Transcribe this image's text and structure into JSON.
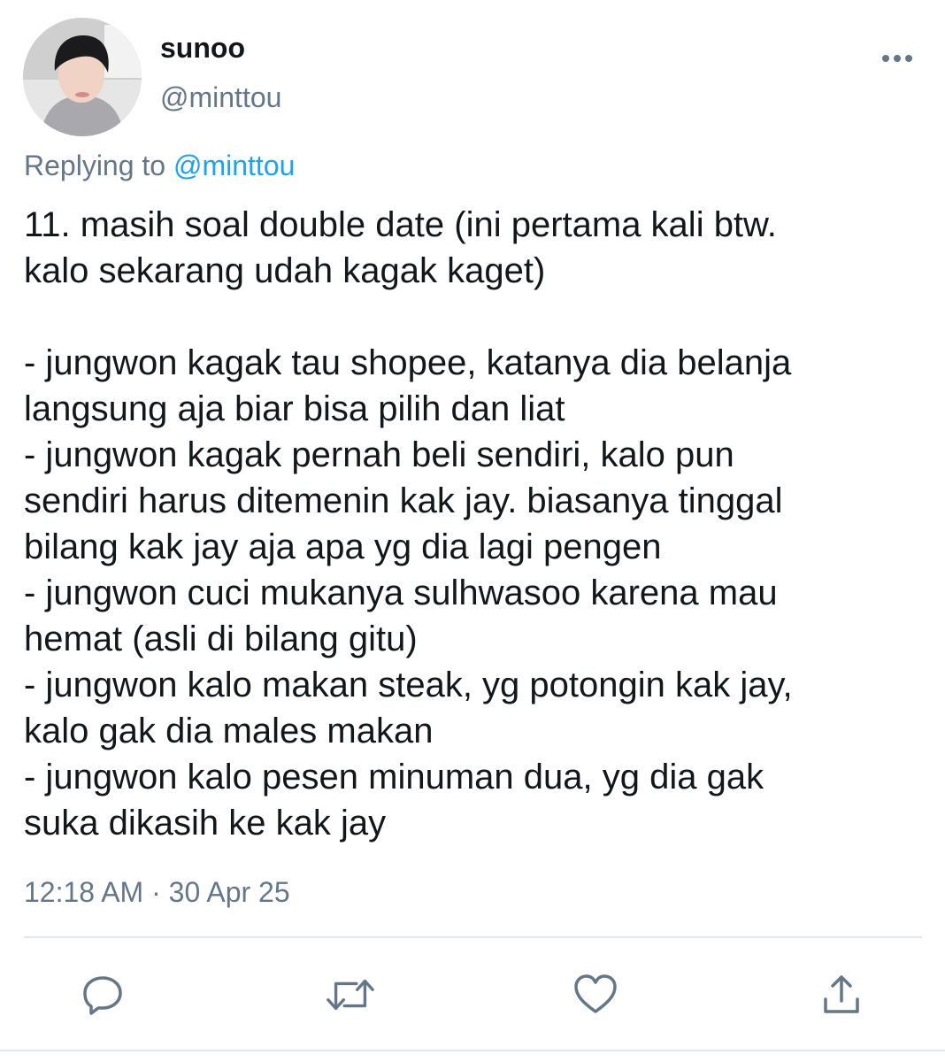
{
  "user": {
    "display_name": "sunoo",
    "handle": "@minttou",
    "avatar_icon": "profile-photo"
  },
  "reply": {
    "prefix": "Replying to",
    "mention": "@minttou"
  },
  "tweet": {
    "text": "11. masih soal double date (ini pertama kali btw.\nkalo sekarang udah kagak kaget)\n\n- jungwon kagak tau shopee, katanya dia belanja\nlangsung aja biar bisa pilih dan liat\n- jungwon kagak pernah beli sendiri, kalo pun\nsendiri harus ditemenin kak jay. biasanya tinggal\nbilang kak jay aja apa yg dia lagi pengen\n- jungwon cuci mukanya sulhwasoo karena mau\nhemat (asli di bilang gitu)\n- jungwon kalo makan steak, yg potongin kak jay,\nkalo gak dia males makan\n- jungwon kalo pesen minuman dua, yg dia gak\nsuka dikasih ke kak jay",
    "timestamp": "12:18 AM · 30 Apr 25"
  },
  "actions": [
    {
      "icon": "reply-icon"
    },
    {
      "icon": "retweet-icon"
    },
    {
      "icon": "like-icon"
    },
    {
      "icon": "share-icon"
    }
  ],
  "colors": {
    "accent": "#1da1f2",
    "secondary_text": "#657786",
    "primary_text": "#14171a",
    "divider": "#e1e8ed"
  }
}
